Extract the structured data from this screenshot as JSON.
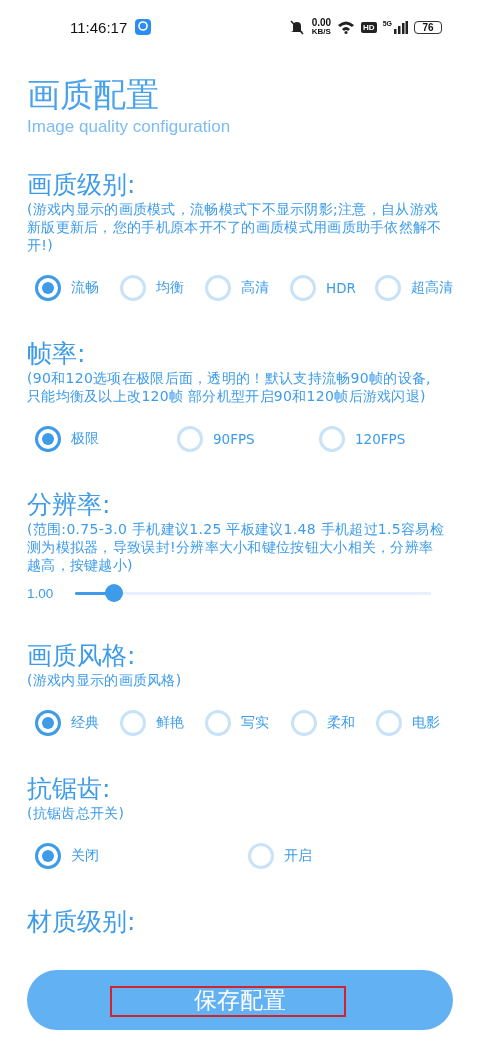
{
  "status_bar": {
    "time": "11:46:17",
    "net_speed": "0.00",
    "net_unit": "KB/S",
    "hd": "HD",
    "network": "5G",
    "battery": "76"
  },
  "title": "画质配置",
  "subtitle": "Image quality configuration",
  "sections": [
    {
      "kind": "radio",
      "heading": "画质级别:",
      "description": "(游戏内显示的画质模式，流畅模式下不显示阴影;注意，自从游戏新版更新后，您的手机原本开不了的画质模式用画质助手依然解不开!)",
      "options": [
        {
          "label": "流畅",
          "selected": true
        },
        {
          "label": "均衡",
          "selected": false
        },
        {
          "label": "高清",
          "selected": false
        },
        {
          "label": "HDR",
          "selected": false
        },
        {
          "label": "超高清",
          "selected": false
        }
      ]
    },
    {
      "kind": "radio",
      "heading": "帧率:",
      "description": "(90和120选项在极限后面，透明的！默认支持流畅90帧的设备,只能均衡及以上改120帧  部分机型开启90和120帧后游戏闪退)",
      "options": [
        {
          "label": "极限",
          "selected": true
        },
        {
          "label": "90FPS",
          "selected": false
        },
        {
          "label": "120FPS",
          "selected": false
        }
      ]
    },
    {
      "kind": "slider",
      "heading": "分辨率:",
      "description": "(范围:0.75-3.0  手机建议1.25 平板建议1.48  手机超过1.5容易检测为模拟器，导致误封!分辨率大小和键位按钮大小相关，分辨率越高，按键越小)",
      "value": "1.00",
      "level": 0.11
    },
    {
      "kind": "radio",
      "heading": "画质风格:",
      "description": "(游戏内显示的画质风格)",
      "options": [
        {
          "label": "经典",
          "selected": true
        },
        {
          "label": "鲜艳",
          "selected": false
        },
        {
          "label": "写实",
          "selected": false
        },
        {
          "label": "柔和",
          "selected": false
        },
        {
          "label": "电影",
          "selected": false
        }
      ]
    },
    {
      "kind": "radio",
      "heading": "抗锯齿:",
      "description": "(抗锯齿总开关)",
      "options": [
        {
          "label": "关闭",
          "selected": true
        },
        {
          "label": "开启",
          "selected": false
        }
      ]
    },
    {
      "kind": "heading",
      "heading": "材质级别:"
    }
  ],
  "save_button": {
    "label": "保存配置",
    "highlighted": true
  }
}
